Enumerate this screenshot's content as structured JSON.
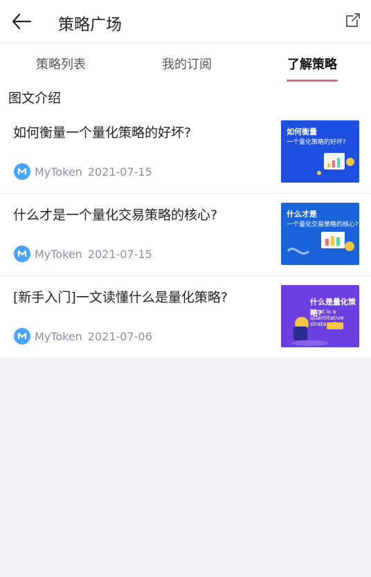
{
  "header": {
    "title": "策略广场"
  },
  "tabs": [
    {
      "label": "策略列表"
    },
    {
      "label": "我的订阅"
    },
    {
      "label": "了解策略"
    }
  ],
  "section": {
    "title": "图文介绍"
  },
  "items": [
    {
      "title": "如何衡量一个量化策略的好坏?",
      "author": "MyToken",
      "date": "2021-07-15",
      "thumb_title": "如何衡量",
      "thumb_sub": "一个量化策略的好坏?"
    },
    {
      "title": "什么才是一个量化交易策略的核心?",
      "author": "MyToken",
      "date": "2021-07-15",
      "thumb_title": "什么才是",
      "thumb_sub": "一个量化交易策略的核心?"
    },
    {
      "title": "[新手入门]一文读懂什么是量化策略?",
      "author": "MyToken",
      "date": "2021-07-06",
      "thumb_title": "什么是量化策略?",
      "thumb_sub": "What is a quantitative strategy?"
    }
  ],
  "colors": {
    "accent": "#d26b79",
    "logo": "#4aa3ff"
  }
}
